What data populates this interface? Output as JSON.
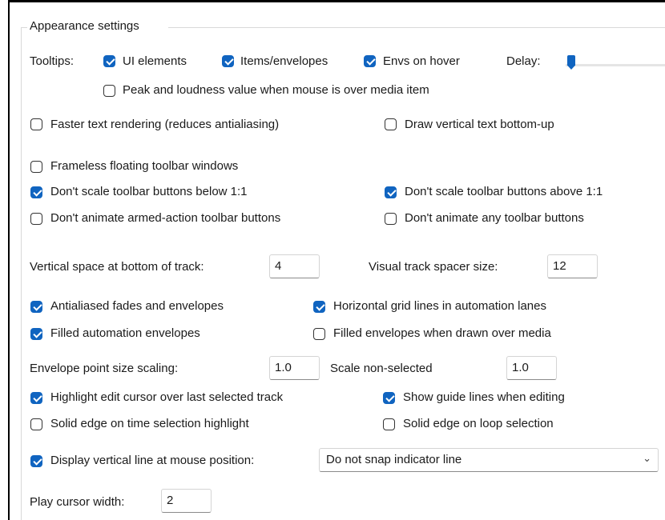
{
  "group": {
    "title": "Appearance settings"
  },
  "tooltips": {
    "label": "Tooltips:",
    "ui_elements": {
      "label": "UI elements",
      "checked": true
    },
    "items_envelopes": {
      "label": "Items/envelopes",
      "checked": true
    },
    "envs_on_hover": {
      "label": "Envs on hover",
      "checked": true
    },
    "delay_label": "Delay:",
    "delay_value": 0.02,
    "peak_loudness": {
      "label": "Peak and loudness value when mouse is over media item",
      "checked": false
    }
  },
  "rendering": {
    "faster_text": {
      "label": "Faster text rendering (reduces antialiasing)",
      "checked": false
    },
    "vertical_text": {
      "label": "Draw vertical text bottom-up",
      "checked": false
    }
  },
  "toolbar": {
    "frameless": {
      "label": "Frameless floating toolbar windows",
      "checked": false
    },
    "no_scale_below": {
      "label": "Don't scale toolbar buttons below 1:1",
      "checked": true
    },
    "no_scale_above": {
      "label": "Don't scale toolbar buttons above 1:1",
      "checked": true
    },
    "no_animate_armed": {
      "label": "Don't animate armed-action toolbar buttons",
      "checked": false
    },
    "no_animate_any": {
      "label": "Don't animate any toolbar buttons",
      "checked": false
    }
  },
  "track": {
    "vertical_space_label": "Vertical space at bottom of track:",
    "vertical_space_value": "4",
    "spacer_label": "Visual track spacer size:",
    "spacer_value": "12"
  },
  "envelopes": {
    "antialiased": {
      "label": "Antialiased fades and envelopes",
      "checked": true
    },
    "grid_lines": {
      "label": "Horizontal grid lines in automation lanes",
      "checked": true
    },
    "filled_auto": {
      "label": "Filled automation envelopes",
      "checked": true
    },
    "filled_over_media": {
      "label": "Filled envelopes when drawn over media",
      "checked": false
    },
    "point_scale_label": "Envelope point size scaling:",
    "point_scale_value": "1.0",
    "non_selected_label": "Scale non-selected",
    "non_selected_value": "1.0"
  },
  "cursor": {
    "highlight_edit": {
      "label": "Highlight edit cursor over last selected track",
      "checked": true
    },
    "guide_lines": {
      "label": "Show guide lines when editing",
      "checked": true
    },
    "solid_time_sel": {
      "label": "Solid edge on time selection highlight",
      "checked": false
    },
    "solid_loop_sel": {
      "label": "Solid edge on loop selection",
      "checked": false
    },
    "vertical_line": {
      "label": "Display vertical line at mouse position:",
      "checked": true
    },
    "snap_select_value": "Do not snap indicator line",
    "play_width_label": "Play cursor width:",
    "play_width_value": "2"
  },
  "icons": {
    "dropdown": "chevron-down-icon"
  },
  "colors": {
    "accent": "#1064c0"
  }
}
